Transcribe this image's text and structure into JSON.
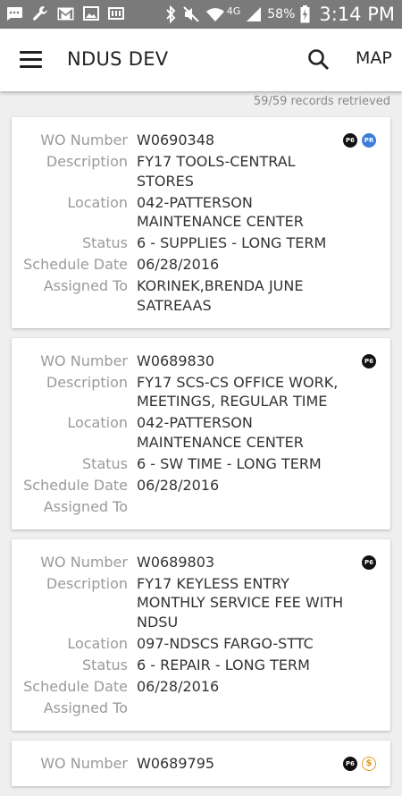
{
  "status_bar": {
    "network": "4G",
    "battery": "58%",
    "time": "3:14 PM"
  },
  "app_bar": {
    "title": "NDUS DEV",
    "map_label": "MAP"
  },
  "records_text": "59/59 records retrieved",
  "labels": {
    "wo_number": "WO Number",
    "description": "Description",
    "location": "Location",
    "status": "Status",
    "schedule_date": "Schedule Date",
    "assigned_to": "Assigned To"
  },
  "work_orders": [
    {
      "wo_number": "W0690348",
      "description": "FY17 TOOLS-CENTRAL STORES",
      "location": "042-PATTERSON MAINTENANCE CENTER",
      "status": "6 - SUPPLIES - LONG TERM",
      "schedule_date": "06/28/2016",
      "assigned_to": "KORINEK,BRENDA JUNE SATREAAS",
      "badges": [
        "P6",
        "PR"
      ]
    },
    {
      "wo_number": "W0689830",
      "description": "FY17 SCS-CS OFFICE WORK, MEETINGS, REGULAR TIME",
      "location": "042-PATTERSON MAINTENANCE CENTER",
      "status": "6 - SW TIME - LONG TERM",
      "schedule_date": "06/28/2016",
      "assigned_to": "",
      "badges": [
        "P6"
      ]
    },
    {
      "wo_number": "W0689803",
      "description": "FY17 KEYLESS ENTRY MONTHLY SERVICE FEE WITH NDSU",
      "location": "097-NDSCS FARGO-STTC",
      "status": "6 - REPAIR - LONG TERM",
      "schedule_date": "06/28/2016",
      "assigned_to": "",
      "badges": [
        "P6"
      ]
    },
    {
      "wo_number": "W0689795",
      "badges": [
        "P6",
        "$"
      ]
    }
  ],
  "colors": {
    "status_bar": "#7a7a7a",
    "label_gray": "#9a9a9a",
    "value_text": "#333333",
    "badge_pr_blue": "#3b7dd8",
    "badge_dollar_orange": "#e29a1c"
  }
}
